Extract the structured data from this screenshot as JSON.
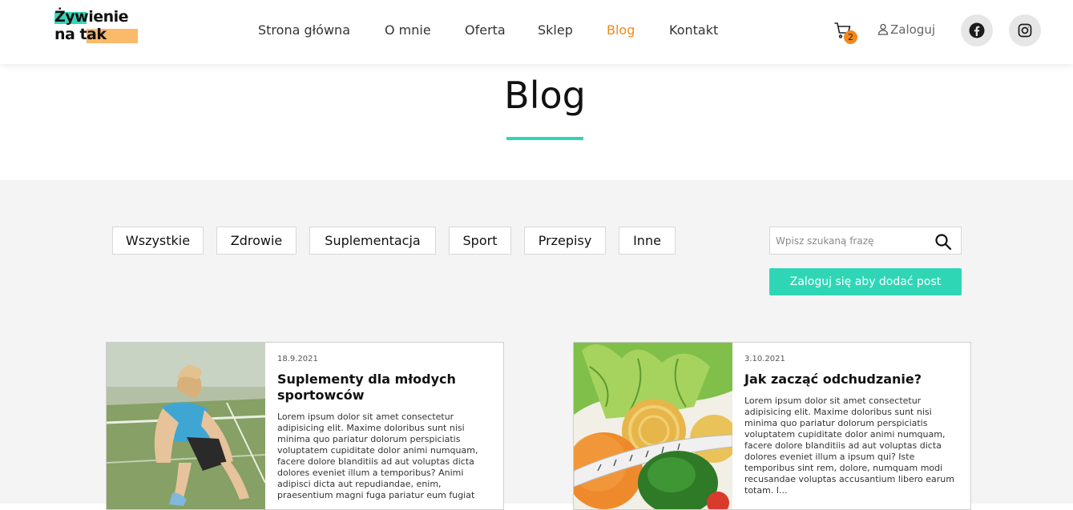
{
  "logo": {
    "line1": "Żywienie",
    "line2": "na tak"
  },
  "nav": {
    "items": [
      {
        "label": "Strona główna",
        "active": false
      },
      {
        "label": "O mnie",
        "active": false
      },
      {
        "label": "Oferta",
        "active": false
      },
      {
        "label": "Sklep",
        "active": false
      },
      {
        "label": "Blog",
        "active": true
      },
      {
        "label": "Kontakt",
        "active": false
      }
    ]
  },
  "header": {
    "cart_icon": "cart-icon",
    "cart_count": "2",
    "login_label": "Zaloguj",
    "social": [
      "facebook-icon",
      "instagram-icon"
    ]
  },
  "page": {
    "title": "Blog"
  },
  "filters": {
    "items": [
      {
        "label": "Wszystkie"
      },
      {
        "label": "Zdrowie"
      },
      {
        "label": "Suplementacja"
      },
      {
        "label": "Sport"
      },
      {
        "label": "Przepisy"
      },
      {
        "label": "Inne"
      }
    ]
  },
  "search": {
    "placeholder": "Wpisz szukaną frazę",
    "value": ""
  },
  "add_post_label": "Zaloguj się aby dodać post",
  "posts": [
    {
      "date": "18.9.2021",
      "title": "Suplementy dla młodych sportowców",
      "excerpt": "Lorem ipsum dolor sit amet consectetur adipisicing elit. Maxime doloribus sunt nisi minima quo pariatur dolorum perspiciatis voluptatem cupiditate dolor animi numquam, facere dolore blanditiis ad aut voluptas dicta dolores eveniet illum a temporibus? Animi adipisci dicta aut repudiandae, enim, praesentium magni fuga pariatur eum fugiat"
    },
    {
      "date": "3.10.2021",
      "title": "Jak zacząć odchudzanie?",
      "excerpt": "Lorem ipsum dolor sit amet consectetur adipisicing elit. Maxime doloribus sunt nisi minima quo pariatur dolorum perspiciatis voluptatem cupiditate dolor animi numquam, facere dolore blanditiis ad aut voluptas dicta dolores eveniet illum a ipsum qui? Iste temporibus sint rem, dolore, numquam modi recusandae voluptas accusantium libero earum totam. I..."
    }
  ],
  "colors": {
    "accent": "#2fd6b6",
    "active_nav": "#f0891c",
    "badge": "#f0891c",
    "logo_highlight_1": "#3ad4b8",
    "logo_highlight_2": "#fbb96a"
  }
}
